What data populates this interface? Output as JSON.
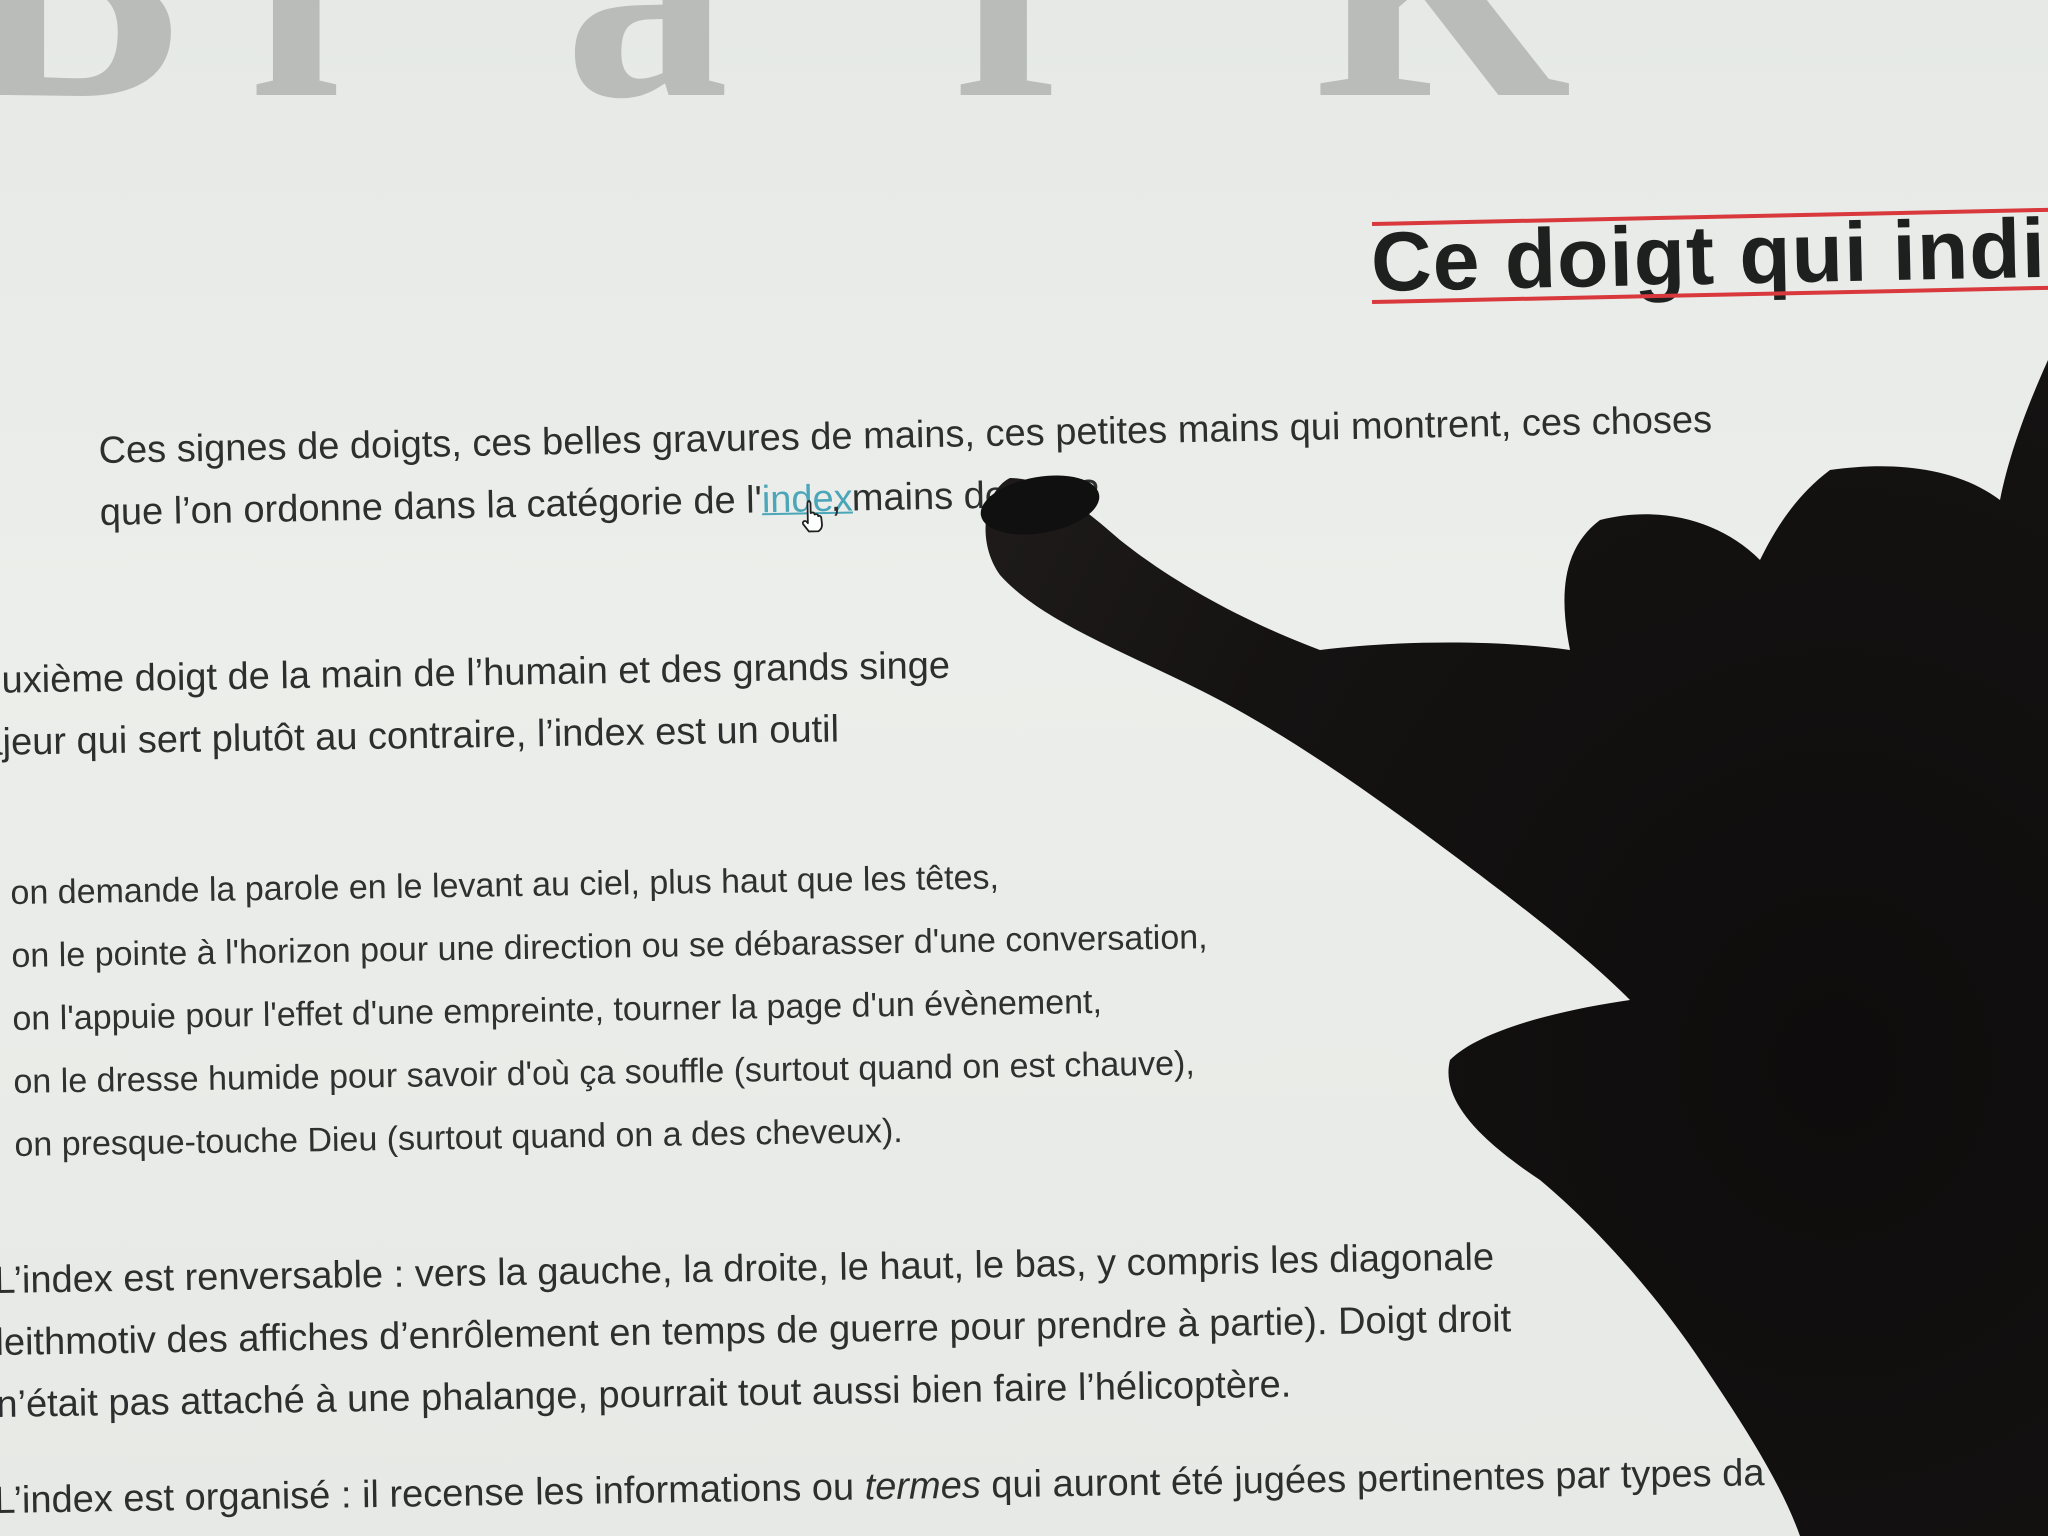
{
  "page": {
    "masthead_text": "Bl a r K",
    "title": "Ce doigt qui indiq",
    "intro": {
      "line1": "Ces signes de doigts, ces belles gravures de mains, ces petites mains qui montrent, ces choses",
      "line2_before": "que l’on ordonne dans la catégorie de l'",
      "line2_link": "index",
      "line2_after": ",            mains de qui ?"
    },
    "definition": {
      "line1": "euxième doigt de la main de l’humain et des grands singe",
      "line2": "ajeur qui sert plutôt au contraire, l’index est un outil"
    },
    "uses": [
      "on demande la parole en le levant au ciel, plus haut que les têtes,",
      "on le pointe à l'horizon pour une direction ou se débarasser d'une conversation,",
      "on l'appuie pour l'effet d'une empreinte, tourner la page d'un évènement,",
      "on le dresse humide pour savoir d'où ça souffle (surtout quand on est chauve),",
      "on presque-touche Dieu (surtout quand on a des cheveux)."
    ],
    "reversible": {
      "line1": "L’index est renversable : vers la gauche, la droite, le haut, le bas, y compris les diagonale",
      "line2": "leithmotiv des affiches d’enrôlement en temps de guerre pour prendre à partie). Doigt droit",
      "line3": "n’était pas attaché à une phalange, pourrait tout aussi bien faire l’hélicoptère."
    },
    "organised": {
      "before": "L’index est organisé : il recense les informations ou ",
      "italic": "termes",
      "after": " qui auront été jugées pertinentes par types da"
    }
  },
  "colors": {
    "link": "#4aa6b8",
    "title_rule": "#d9383c",
    "text": "#2d2f2e"
  },
  "icons": {
    "cursor": "hand-pointer-cursor",
    "hand": "pointing-hand-silhouette"
  }
}
